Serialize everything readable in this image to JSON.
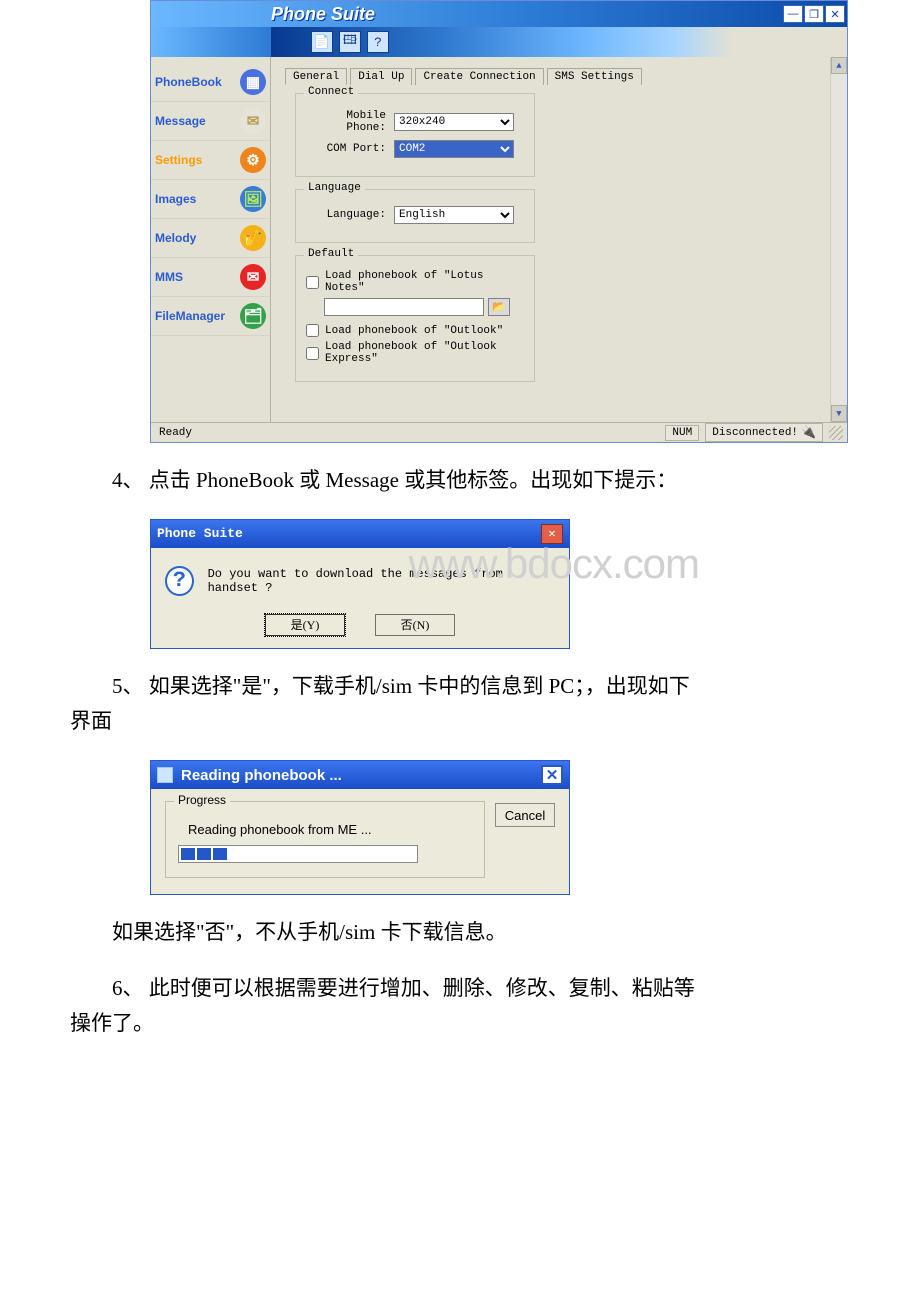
{
  "phoneSuite": {
    "title": "Phone Suite",
    "titleButtons": {
      "min": "—",
      "max": "❐",
      "close": "✕"
    },
    "toolbarIcons": [
      "📄",
      "🖽",
      "?"
    ],
    "nav": [
      {
        "label": "PhoneBook",
        "iconClass": "ic-book",
        "glyph": "▦"
      },
      {
        "label": "Message",
        "iconClass": "ic-msg",
        "glyph": "✉"
      },
      {
        "label": "Settings",
        "iconClass": "ic-set",
        "glyph": "⚙",
        "active": true
      },
      {
        "label": "Images",
        "iconClass": "ic-img",
        "glyph": "🖼"
      },
      {
        "label": "Melody",
        "iconClass": "ic-mel",
        "glyph": "🎷"
      },
      {
        "label": "MMS",
        "iconClass": "ic-mms",
        "glyph": "✉"
      },
      {
        "label": "FileManager",
        "iconClass": "ic-fm",
        "glyph": "🗂"
      }
    ],
    "tabs": [
      "General",
      "Dial Up",
      "Create Connection",
      "SMS Settings"
    ],
    "activeTab": 0,
    "groups": {
      "connect": {
        "title": "Connect",
        "mobileLabel": "Mobile Phone:",
        "mobileValue": "320x240",
        "comLabel": "COM Port:",
        "comValue": "COM2"
      },
      "language": {
        "title": "Language",
        "label": "Language:",
        "value": "English"
      },
      "defaults": {
        "title": "Default",
        "lotus": "Load phonebook of \"Lotus Notes\"",
        "outlook": "Load phonebook of \"Outlook\"",
        "outlookExpress": "Load phonebook of \"Outlook Express\""
      }
    },
    "status": {
      "ready": "Ready",
      "num": "NUM",
      "disc": "Disconnected!"
    }
  },
  "step4": "4、 点击 PhoneBook 或 Message 或其他标签。出现如下提示：",
  "msgbox": {
    "title": "Phone Suite",
    "text": "Do you want to download the messages from handset ?",
    "yes": "是(Y)",
    "no": "否(N)",
    "watermark": "www.bdocx.com"
  },
  "step5a": "5、 如果选择\"是\"，下载手机/sim 卡中的信息到 PC；，出现如下",
  "step5b": "界面",
  "prog": {
    "title": "Reading phonebook ...",
    "group": "Progress",
    "text": "Reading phonebook from ME ...",
    "cancel": "Cancel"
  },
  "afterProg": "如果选择\"否\"，不从手机/sim 卡下载信息。",
  "step6a": "6、 此时便可以根据需要进行增加、删除、修改、复制、粘贴等",
  "step6b": "操作了。"
}
